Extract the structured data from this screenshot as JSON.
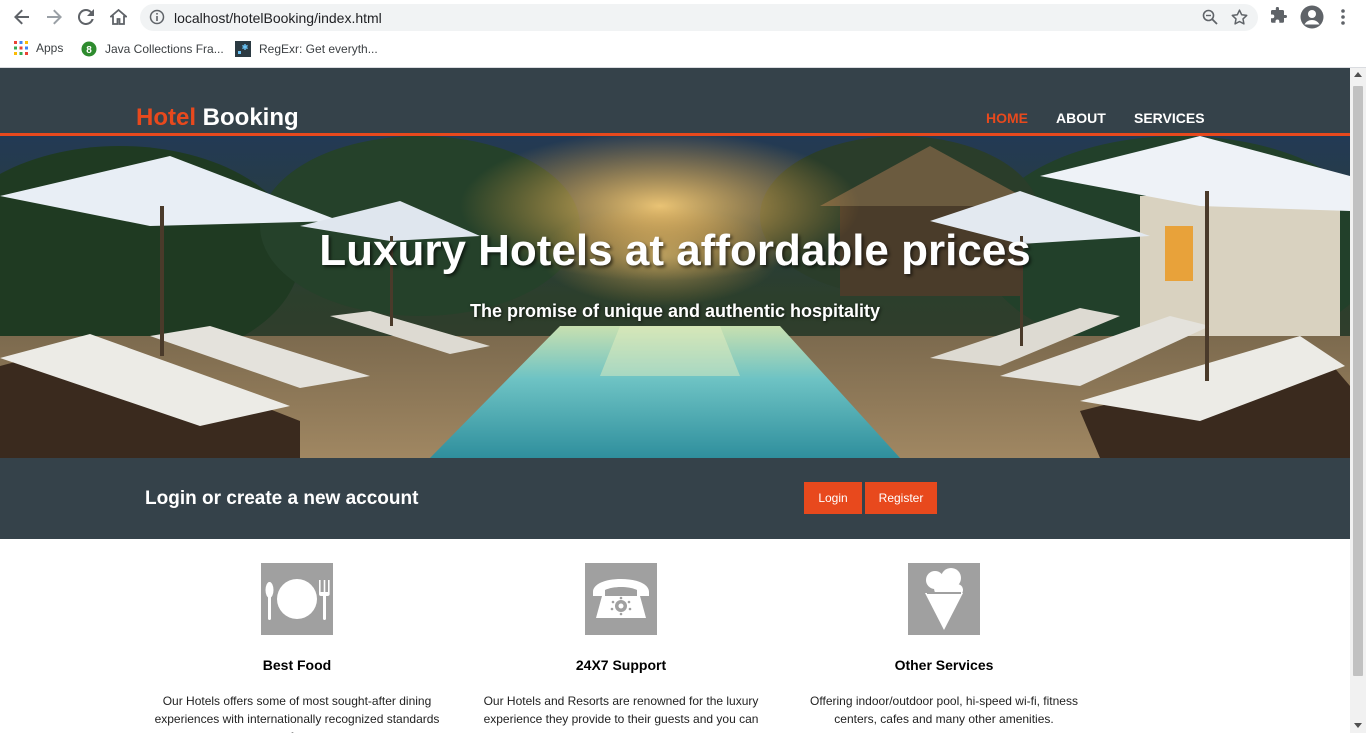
{
  "browser": {
    "url": "localhost/hotelBooking/index.html",
    "bookmarks": [
      {
        "label": "Apps",
        "icon": "apps-grid-icon"
      },
      {
        "label": "Java Collections Fra...",
        "icon": "java-favicon-icon"
      },
      {
        "label": "RegExr: Get everyth...",
        "icon": "regexr-favicon-icon"
      }
    ]
  },
  "site": {
    "logo_highlight": "Hotel",
    "logo_rest": " Booking",
    "nav": [
      {
        "label": "HOME",
        "active": true
      },
      {
        "label": "ABOUT",
        "active": false
      },
      {
        "label": "SERVICES",
        "active": false
      }
    ],
    "accent_color": "#e8491d",
    "dark_color": "#35424a"
  },
  "showcase": {
    "title": "Luxury Hotels at affordable prices",
    "subtitle": "The promise of unique and authentic hospitality"
  },
  "login": {
    "heading": "Login or create a new account",
    "login_label": "Login",
    "register_label": "Register"
  },
  "boxes": [
    {
      "icon": "plate-cutlery-icon",
      "title": "Best Food",
      "text": "Our Hotels offers some of most sought-after dining experiences with internationally recognized standards for"
    },
    {
      "icon": "telephone-icon",
      "title": "24X7 Support",
      "text": "Our Hotels and Resorts are renowned for the luxury experience they provide to their guests and you can rest"
    },
    {
      "icon": "ice-cream-icon",
      "title": "Other Services",
      "text": "Offering indoor/outdoor pool, hi-speed wi-fi, fitness centers, cafes and many other amenities."
    }
  ]
}
